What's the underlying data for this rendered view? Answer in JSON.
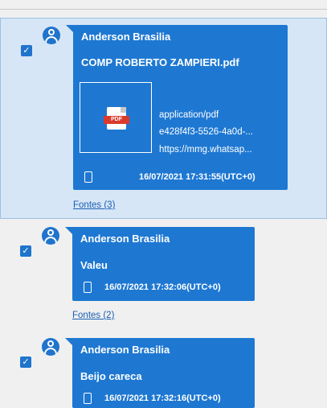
{
  "messages": [
    {
      "sender": "Anderson Brasilia",
      "text": "COMP ROBERTO ZAMPIERI.pdf",
      "selected": true,
      "checked": true,
      "attachment": {
        "icon": "pdf-file-icon",
        "icon_label": "PDF",
        "mime": "application/pdf",
        "id": "e428f4f3-5526-4a0d-...",
        "url": "https://mmg.whatsap..."
      },
      "timestamp": "16/07/2021 17:31:55(UTC+0)",
      "sources_link": "Fontes (3)"
    },
    {
      "sender": "Anderson Brasilia",
      "text": "Valeu",
      "selected": false,
      "checked": true,
      "timestamp": "16/07/2021 17:32:06(UTC+0)",
      "sources_link": "Fontes (2)"
    },
    {
      "sender": "Anderson Brasilia",
      "text": "Beijo careca",
      "selected": false,
      "checked": true,
      "timestamp": "16/07/2021 17:32:16(UTC+0)"
    }
  ],
  "colors": {
    "bubble": "#1e78d2",
    "selection": "#d6e6f6",
    "checkbox": "#1f74cc",
    "link": "#1a5fb4",
    "pdf_red": "#d83b2d"
  },
  "icons": {
    "check": "✓",
    "avatar": "user-avatar-icon",
    "device": "phone-icon"
  }
}
